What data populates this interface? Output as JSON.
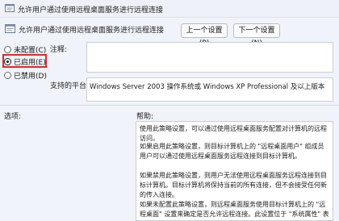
{
  "window": {
    "title": "允许用户通过使用远程桌面服务进行远程连接"
  },
  "header": {
    "policy_name": "允许用户通过使用远程桌面服务进行远程连接",
    "prev_button": "上一个设置(P)",
    "next_button": "下一个设置(N)"
  },
  "state": {
    "not_configured": "未配置(C)",
    "enabled": "已启用(E)",
    "disabled": "已禁用(D)",
    "selected": "enabled"
  },
  "labels": {
    "comment": "注释:",
    "supported_on": "支持的平台:",
    "options": "选项:",
    "help": "帮助:"
  },
  "supported_platforms": "Windows Server 2003 操作系统或 Windows XP Professional 及以上版本",
  "help_paragraphs": [
    "使用此策略设置，可以通过使用远程桌面服务配置对计算机的远程访问。",
    "如果启用此策略设置，则目标计算机上的 \"远程桌面用户\" 组成员用户可以通过使用远程桌面服务远程连接到目标计算机。",
    "如果禁用此策略设置，则用户无法使用远程桌面服务远程连接到目标计算机。目标计算机将保持当前的所有连接，但不会接受任何新的传入连接。",
    "如果未配置此策略设置，则远程桌面服务使用目标计算机上的 \"远程桌面\" 设置来确定是否允许远程连接。此设置位于 \"系统属性\" 表的 \"远程\" 选项卡上。默认情况下，不允许进行远程连接。"
  ],
  "accent": "#e2262b"
}
